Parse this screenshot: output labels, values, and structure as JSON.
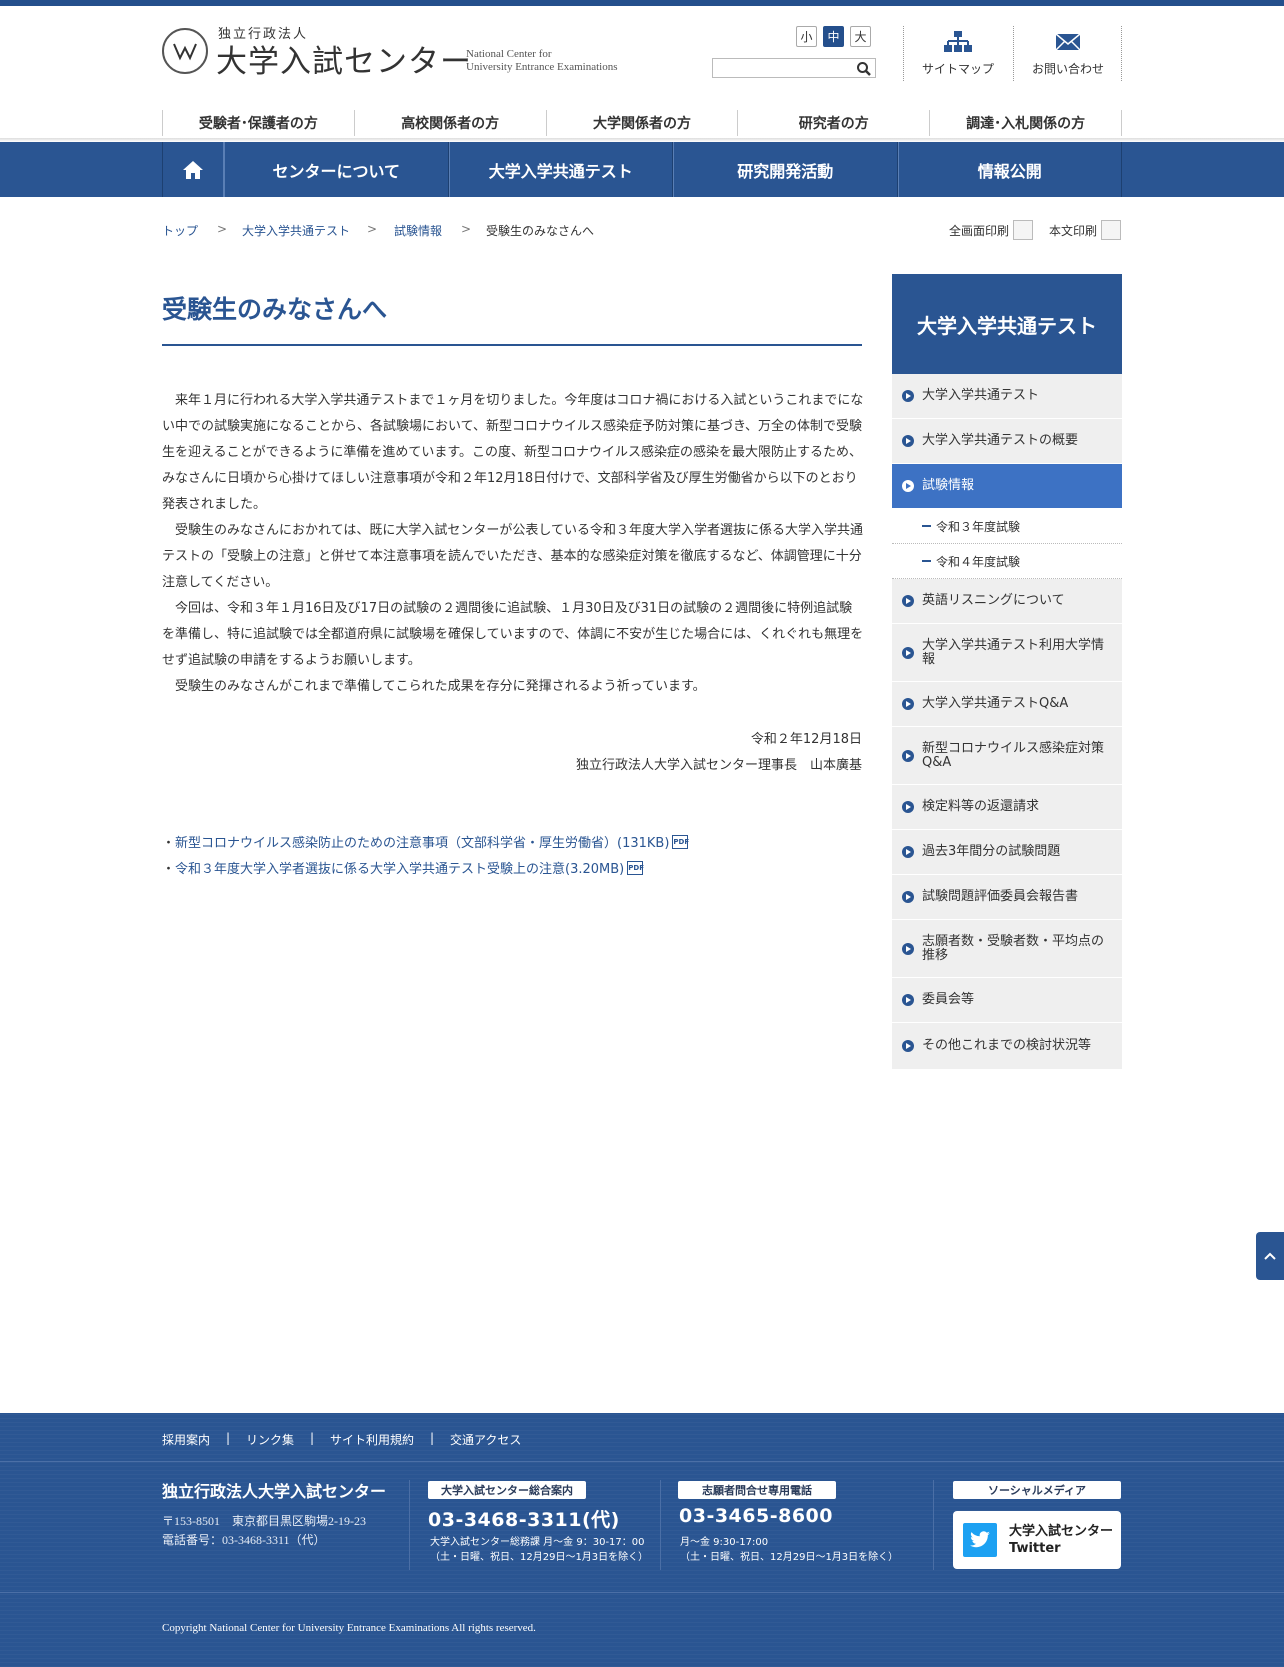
{
  "header": {
    "logo_small": "独立行政法人",
    "logo_big": "大学入試センター",
    "logo_en_1": "National Center for",
    "logo_en_2": "University Entrance Examinations",
    "font_sizes": [
      "小",
      "中",
      "大"
    ],
    "font_size_selected": "中",
    "search_value": "",
    "sitemap_label": "サイトマップ",
    "contact_label": "お問い合わせ"
  },
  "audience_nav": [
    "受験者･保護者の方",
    "高校関係者の方",
    "大学関係者の方",
    "研究者の方",
    "調達･入札関係の方"
  ],
  "main_nav": [
    "センターについて",
    "大学入学共通テスト",
    "研究開発活動",
    "情報公開"
  ],
  "breadcrumb": {
    "items": [
      "トップ",
      "大学入学共通テスト",
      "試験情報"
    ],
    "current": "受験生のみなさんへ",
    "separator": ">"
  },
  "print": {
    "full": "全画面印刷",
    "body": "本文印刷"
  },
  "content": {
    "title": "受験生のみなさんへ",
    "paragraphs": [
      "来年１月に行われる大学入学共通テストまで１ヶ月を切りました。今年度はコロナ禍における入試というこれまでにない中での試験実施になることから、各試験場において、新型コロナウイルス感染症予防対策に基づき、万全の体制で受験生を迎えることができるように準備を進めています。この度、新型コロナウイルス感染症の感染を最大限防止するため、みなさんに日頃から心掛けてほしい注意事項が令和２年12月18日付けで、文部科学省及び厚生労働省から以下のとおり発表されました。",
      "受験生のみなさんにおかれては、既に大学入試センターが公表している令和３年度大学入学者選抜に係る大学入学共通テストの「受験上の注意」と併せて本注意事項を読んでいただき、基本的な感染症対策を徹底するなど、体調管理に十分注意してください。",
      "今回は、令和３年１月16日及び17日の試験の２週間後に追試験、１月30日及び31日の試験の２週間後に特例追試験を準備し、特に追試験では全都道府県に試験場を確保していますので、体調に不安が生じた場合には、くれぐれも無理をせず追試験の申請をするようお願いします。",
      "受験生のみなさんがこれまで準備してこられた成果を存分に発揮されるよう祈っています。"
    ],
    "date": "令和２年12月18日",
    "signature": "独立行政法人大学入試センター理事長　山本廣基",
    "link_prefix": "・",
    "links": [
      "新型コロナウイルス感染防止のための注意事項（文部科学省・厚生労働省）(131KB)",
      "令和３年度大学入学者選抜に係る大学入学共通テスト受験上の注意(3.20MB)"
    ],
    "pdf_label": "PDF"
  },
  "sidebar": {
    "heading": "大学入学共通テスト",
    "items_top": [
      "大学入学共通テスト",
      "大学入学共通テストの概要"
    ],
    "active_item": "試験情報",
    "sub_items": [
      "令和３年度試験",
      "令和４年度試験"
    ],
    "items_bottom": [
      "英語リスニングについて",
      "大学入学共通テスト利用大学情報",
      "大学入学共通テストQ&A",
      "新型コロナウイルス感染症対策Q&A",
      "検定料等の返還請求",
      "過去3年間分の試験問題",
      "試験問題評価委員会報告書",
      "志願者数・受験者数・平均点の推移",
      "委員会等",
      "その他これまでの検討状況等"
    ]
  },
  "footer": {
    "links": [
      "採用案内",
      "リンク集",
      "サイト利用規約",
      "交通アクセス"
    ],
    "link_separator": "|",
    "org": "独立行政法人大学入試センター",
    "address": "〒153-8501　東京都目黒区駒場2-19-23",
    "tel": "電話番号：03-3468-3311（代）",
    "contact1_label": "大学入試センター総合案内",
    "contact1_phone": "03-3468-3311(代)",
    "contact1_hours": "大学入試センター総務課 月～金 9：30-17：00",
    "contact1_note": "（土・日曜、祝日、12月29日～1月3日を除く）",
    "contact2_label": "志願者問合せ専用電話",
    "contact2_phone": "03-3465-8600",
    "contact2_hours": "月～金 9:30-17:00",
    "contact2_note": "（土・日曜、祝日、12月29日～1月3日を除く）",
    "social_label": "ソーシャルメディア",
    "twitter_line1": "大学入試センター",
    "twitter_line2": "Twitter",
    "copyright": "Copyright  National Center for University Entrance Examinations All rights reserved."
  },
  "colors": {
    "brand": "#2a5592",
    "active": "#3d72c4",
    "sidebar_bg": "#efefef"
  }
}
